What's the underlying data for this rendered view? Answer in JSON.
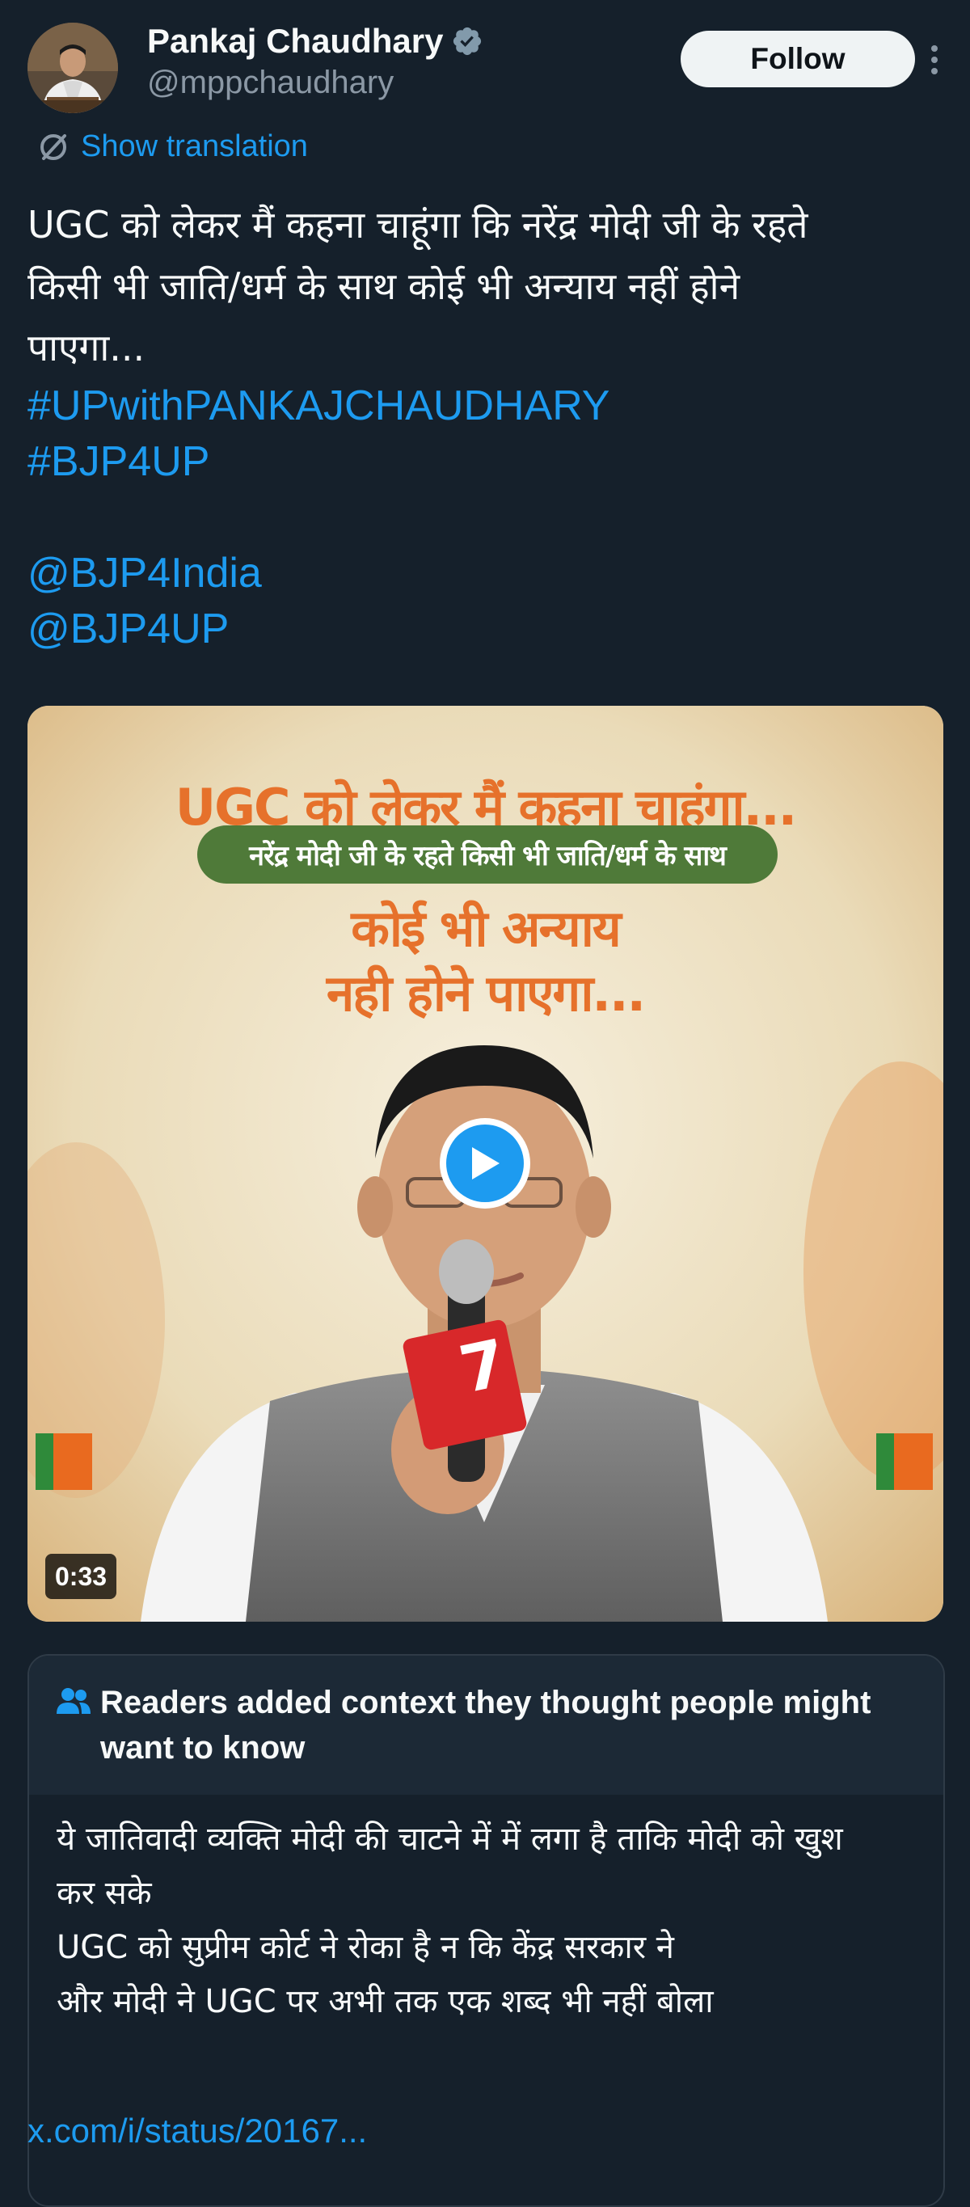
{
  "colors": {
    "background": "#15202b",
    "text_primary": "#f7f9f9",
    "text_secondary": "#8b98a5",
    "accent": "#1d9bf0",
    "verified_badge": "#829aab"
  },
  "author": {
    "display_name": "Pankaj Chaudhary",
    "handle": "@mppchaudhary",
    "verified_icon": "verified-badge-icon",
    "avatar_icon": "avatar"
  },
  "actions": {
    "follow_label": "Follow",
    "more_icon": "more-vertical-icon"
  },
  "translation": {
    "label": "Show translation",
    "icon": "translate-icon"
  },
  "tweet": {
    "text_lines": [
      "UGC को लेकर मैं कहना चाहूंगा कि नरेंद्र मोदी जी के रहते",
      "किसी भी जाति/धर्म के साथ कोई भी अन्याय नहीं होने",
      "पाएगा..."
    ],
    "hashtags": [
      "#UPwithPANKAJCHAUDHARY",
      "#BJP4UP"
    ],
    "mentions": [
      "@BJP4India",
      "@BJP4UP"
    ]
  },
  "media": {
    "headline_1": "UGC को लेकर मैं कहना चाहूंगा...",
    "subheadline": "नरेंद्र मोदी जी के रहते किसी भी जाति/धर्म के साथ",
    "headline_2": "कोई भी अन्याय",
    "headline_3": "नही होने पाएगा...",
    "duration": "0:33",
    "play_icon": "play-icon"
  },
  "community_note": {
    "title": "Readers added context they thought people might want to know",
    "icon": "people-icon",
    "body_lines": [
      "ये जातिवादी व्यक्ति मोदी की चाटने में में लगा है ताकि मोदी को खुश",
      "कर सके",
      "UGC को सुप्रीम कोर्ट ने रोका है न कि केंद्र सरकार ने",
      "और मोदी ने UGC पर अभी तक एक शब्द भी नहीं बोला"
    ],
    "link": "x.com/i/status/20167..."
  }
}
